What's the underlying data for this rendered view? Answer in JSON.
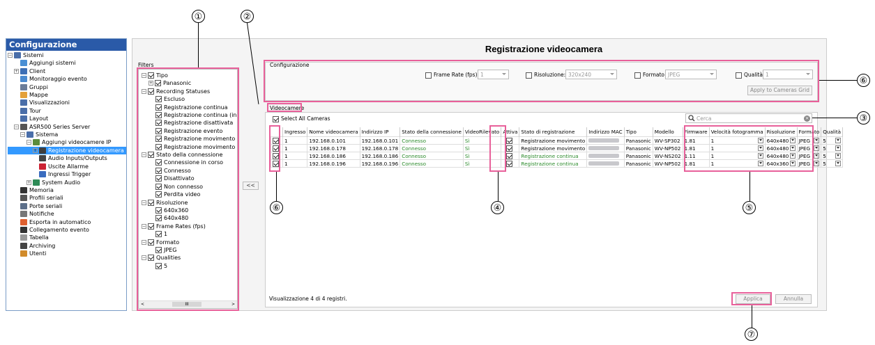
{
  "sidebar": {
    "title": "Configurazione",
    "items": [
      "Sistemi",
      "Aggiungi sistemi",
      "Client",
      "Monitoraggio evento",
      "Gruppi",
      "Mappe",
      "Visualizzazioni",
      "Tour",
      "Layout",
      "ASR500 Series Server",
      "Sistema",
      "Aggiungi videocamere IP",
      "Registrazione videocamera",
      "Audio Inputs/Outputs",
      "Uscite Allarme",
      "Ingressi Trigger",
      "System Audio",
      "Memoria",
      "Profili seriali",
      "Porte seriali",
      "Notifiche",
      "Esporta in automatico",
      "Collegamento evento",
      "Tabella",
      "Archiving",
      "Utenti"
    ]
  },
  "filters": {
    "title": "Filters",
    "items": [
      "Tipo",
      "Panasonic",
      "Recording Statuses",
      "Escluso",
      "Registrazione continua",
      "Registrazione continua (in",
      "Registrazione disattivata",
      "Registrazione evento",
      "Registrazione movimento",
      "Registrazione movimento",
      "Stato della connessione",
      "Connessione in corso",
      "Connesso",
      "Disattivato",
      "Non connesso",
      "Perdita video",
      "Risoluzione",
      "640x360",
      "640x480",
      "Frame Rates (fps)",
      "1",
      "Formato",
      "JPEG",
      "Qualities",
      "5"
    ],
    "scroll_thumb": "III",
    "collapse_button": "<<"
  },
  "main": {
    "title": "Registrazione videocamera",
    "config_label": "Configurazione",
    "frame_rate_label": "Frame Rate (fps):",
    "frame_rate_value": "1",
    "resolution_label": "Risoluzione:",
    "resolution_value": "320x240",
    "format_label": "Formato",
    "format_value": "JPEG",
    "quality_label": "Qualità",
    "quality_value": "1",
    "apply_grid_button": "Apply to Cameras Grid",
    "cameras_label": "Videocamere",
    "select_all": "Select All Cameras",
    "search_placeholder": "Cerca",
    "columns": [
      "Ingresso",
      "Nome videocamera",
      "Indirizzo IP",
      "Stato della connessione",
      "VideoRilevato",
      "Attiva",
      "Stato di registrazione",
      "Indirizzo MAC",
      "Tipo",
      "Modello",
      "Firmware",
      "Velocità fotogramma",
      "Risoluzione",
      "Formato",
      "Qualità"
    ],
    "rows": [
      {
        "ingresso": "1",
        "nome": "192.168.0.101",
        "ip": "192.168.0.101",
        "stato": "Connesso",
        "video": "Sì",
        "reg": "Registrazione movimento",
        "tipo": "Panasonic",
        "modello": "WV-SP302",
        "fw": "1.81",
        "fps": "1",
        "ris": "640x480",
        "fmt": "JPEG",
        "q": "5"
      },
      {
        "ingresso": "1",
        "nome": "192.168.0.178",
        "ip": "192.168.0.178",
        "stato": "Connesso",
        "video": "Sì",
        "reg": "Registrazione movimento",
        "tipo": "Panasonic",
        "modello": "WV-NP502",
        "fw": "1.81",
        "fps": "1",
        "ris": "640x480",
        "fmt": "JPEG",
        "q": "5"
      },
      {
        "ingresso": "1",
        "nome": "192.168.0.186",
        "ip": "192.168.0.186",
        "stato": "Connesso",
        "video": "Sì",
        "reg": "Registrazione continua",
        "tipo": "Panasonic",
        "modello": "WV-NS202",
        "fw": "1.11",
        "fps": "1",
        "ris": "640x480",
        "fmt": "JPEG",
        "q": "5"
      },
      {
        "ingresso": "1",
        "nome": "192.168.0.196",
        "ip": "192.168.0.196",
        "stato": "Connesso",
        "video": "Sì",
        "reg": "Registrazione continua",
        "tipo": "Panasonic",
        "modello": "WV-NP502",
        "fw": "1.81",
        "fps": "1",
        "ris": "640x360",
        "fmt": "JPEG",
        "q": "5"
      }
    ],
    "status_text": "Visualizzazione 4 di 4 registri.",
    "apply_button": "Applica",
    "cancel_button": "Annulla"
  },
  "callouts": [
    "①",
    "②",
    "③",
    "④",
    "⑤",
    "⑥",
    "⑦",
    "⑥"
  ]
}
